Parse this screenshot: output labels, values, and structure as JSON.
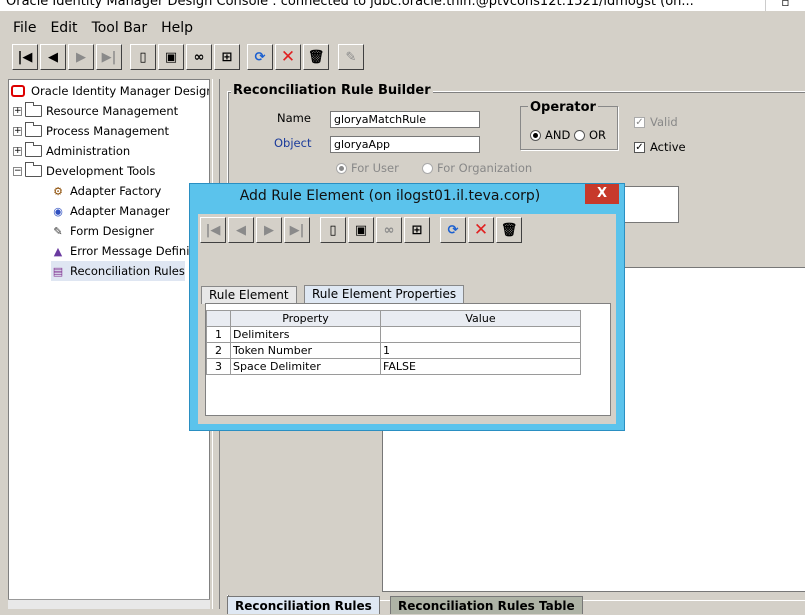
{
  "window": {
    "title": "Oracle Identity Manager Design Console : connected to jdbc:oracle:thin:@ptvcons12t:1521/idmogst (on..."
  },
  "menu": [
    {
      "label": "File",
      "ul": "F"
    },
    {
      "label": "Edit",
      "ul": "E"
    },
    {
      "label": "Tool Bar",
      "ul": "T"
    },
    {
      "label": "Help",
      "ul": "H"
    }
  ],
  "toolbar": {
    "buttons": [
      "first-record-icon",
      "previous-record-icon",
      "next-record-icon",
      "last-record-icon",
      "new-form-icon",
      "save-icon",
      "query-binoculars-icon",
      "assign-icon",
      "refresh-icon",
      "delete-icon",
      "trash-icon",
      "edit-icon"
    ]
  },
  "tree": {
    "root": "Oracle Identity Manager Design",
    "folders": [
      "Resource Management",
      "Process Management",
      "Administration",
      "Development Tools"
    ],
    "dev_tools_children": [
      "Adapter Factory",
      "Adapter Manager",
      "Form Designer",
      "Error Message Defini",
      "Reconciliation Rules"
    ]
  },
  "rule_builder": {
    "title": "Reconciliation Rule Builder",
    "name_label": "Name",
    "name_value": "gloryaMatchRule",
    "object_label": "Object",
    "object_value": "gloryaApp",
    "operator_title": "Operator",
    "op_and": "AND",
    "op_or": "OR",
    "valid_label": "Valid",
    "active_label": "Active",
    "for_user": "For User",
    "for_org": "For Organization"
  },
  "bottom_tabs": [
    "Reconciliation Rules",
    "Reconciliation Rules Table"
  ],
  "dialog": {
    "title": "Add Rule Element (on ilogst01.il.teva.corp)",
    "close": "X",
    "tabs": [
      "Rule Element",
      "Rule Element Properties"
    ],
    "columns": [
      "Property",
      "Value"
    ],
    "rows": [
      {
        "n": "1",
        "property": "Delimiters",
        "value": ""
      },
      {
        "n": "2",
        "property": "Token Number",
        "value": "1"
      },
      {
        "n": "3",
        "property": "Space Delimiter",
        "value": "FALSE"
      }
    ]
  },
  "colors": {
    "dialog_frame": "#5bc3ec",
    "close_button": "#c7392b",
    "delete_red": "#e02020",
    "refresh_blue": "#1a5fd0"
  }
}
